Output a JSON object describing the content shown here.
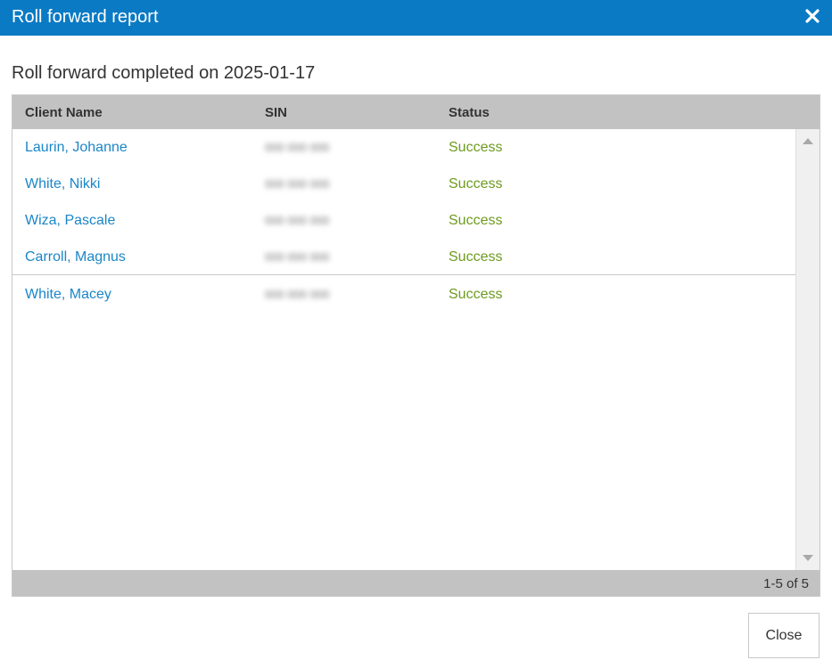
{
  "dialog": {
    "title": "Roll forward report",
    "subtitle": "Roll forward completed on 2025-01-17",
    "close_button_label": "Close"
  },
  "grid": {
    "columns": [
      "Client Name",
      "SIN",
      "Status"
    ],
    "rows": [
      {
        "name": "Laurin, Johanne",
        "sin": "000 000 000",
        "status": "Success"
      },
      {
        "name": "White, Nikki",
        "sin": "000 000 000",
        "status": "Success"
      },
      {
        "name": "Wiza, Pascale",
        "sin": "000 000 000",
        "status": "Success"
      },
      {
        "name": "Carroll, Magnus",
        "sin": "000 000 000",
        "status": "Success"
      },
      {
        "name": "White, Macey",
        "sin": "000 000 000",
        "status": "Success"
      }
    ],
    "pager_text": "1-5 of 5"
  },
  "icons": {
    "close": "close-icon",
    "scroll_up": "scroll-up-arrow-icon",
    "scroll_down": "scroll-down-arrow-icon"
  },
  "colors": {
    "titlebar": "#0a7ac4",
    "link": "#1a86c8",
    "success": "#6e9a1f",
    "header_bg": "#c2c2c2"
  }
}
